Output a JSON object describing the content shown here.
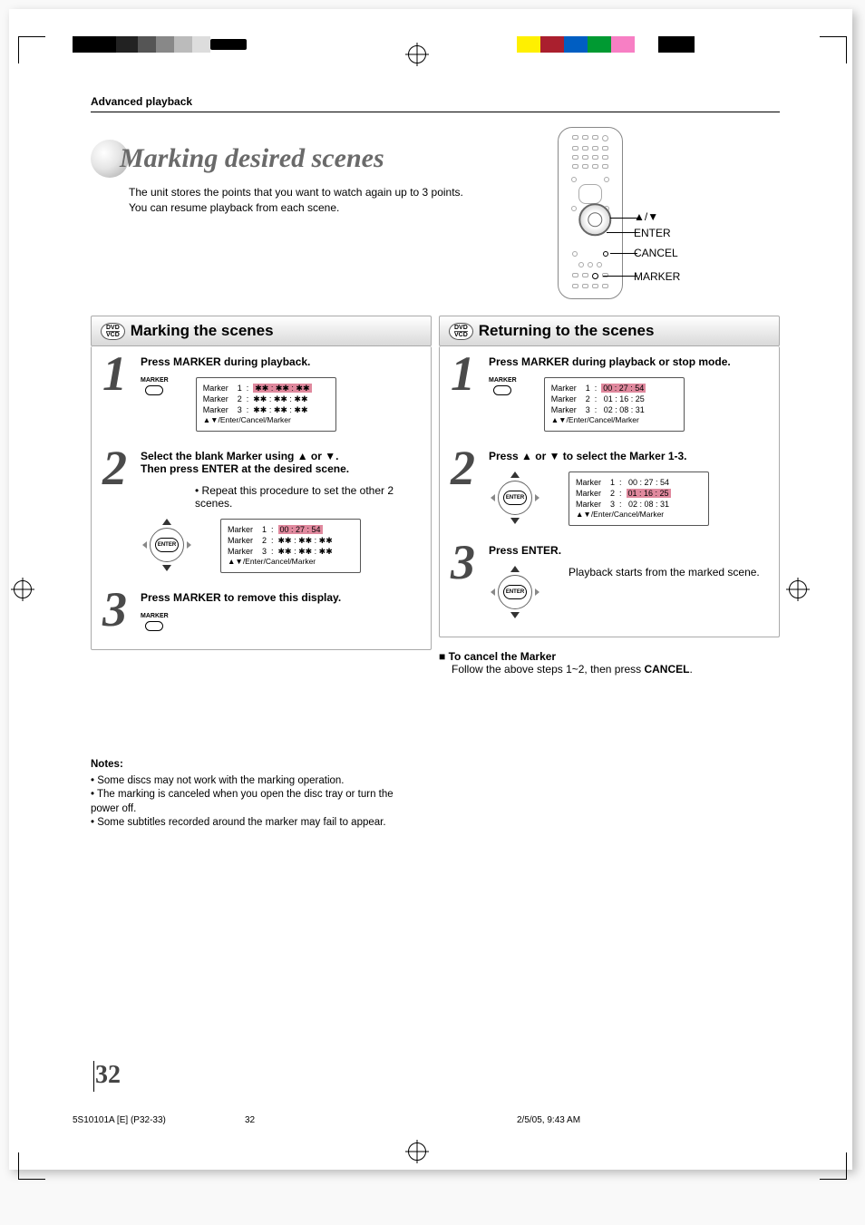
{
  "header": {
    "section": "Advanced playback"
  },
  "title": "Marking desired scenes",
  "intro_line1": "The unit stores the points that you want to watch again up to 3 points.",
  "intro_line2": "You can resume playback from each scene.",
  "remote_labels": {
    "arrows": "▲/▼",
    "enter": "ENTER",
    "cancel": "CANCEL",
    "marker": "MARKER"
  },
  "badge": {
    "dvd": "DVD",
    "vcd": "VCD"
  },
  "left": {
    "heading": "Marking the scenes",
    "step1": {
      "title": "Press MARKER during playback.",
      "osd": {
        "r1a": "Marker    1  :  ",
        "r1b": "✱✱ : ✱✱ : ✱✱",
        "r2": "Marker    2  :  ✱✱ : ✱✱ : ✱✱",
        "r3": "Marker    3  :  ✱✱ : ✱✱ : ✱✱",
        "footer": "▲▼/Enter/Cancel/Marker"
      }
    },
    "step2": {
      "title_l1": "Select the blank Marker using ▲ or ▼.",
      "title_l2": "Then press ENTER at the desired scene.",
      "note": "• Repeat this procedure to set the other 2 scenes.",
      "osd": {
        "r1a": "Marker    1  :  ",
        "r1b": "00 : 27 : 54",
        "r2": "Marker    2  :  ✱✱ : ✱✱ : ✱✱",
        "r3": "Marker    3  :  ✱✱ : ✱✱ : ✱✱",
        "footer": "▲▼/Enter/Cancel/Marker"
      }
    },
    "step3": {
      "title": "Press MARKER to remove this display."
    }
  },
  "right": {
    "heading": "Returning to the scenes",
    "step1": {
      "title": "Press MARKER during playback or stop mode.",
      "osd": {
        "r1a": "Marker    1  :  ",
        "r1b": "00 : 27 : 54",
        "r2": "Marker    2  :   01 : 16 : 25",
        "r3": "Marker    3  :   02 : 08 : 31",
        "footer": "▲▼/Enter/Cancel/Marker"
      }
    },
    "step2": {
      "title": "Press ▲ or ▼ to select the Marker 1-3.",
      "osd": {
        "r1": "Marker    1  :   00 : 27 : 54",
        "r2a": "Marker    2  :  ",
        "r2b": "01 : 16 : 25",
        "r3": "Marker    3  :   02 : 08 : 31",
        "footer": "▲▼/Enter/Cancel/Marker"
      }
    },
    "step3": {
      "title": "Press ENTER.",
      "note": "Playback starts from the marked scene."
    },
    "cancel": {
      "heading": "To cancel the Marker",
      "text_a": "Follow the above steps 1~2, then press ",
      "text_b": "CANCEL",
      "text_c": "."
    }
  },
  "notes": {
    "heading": "Notes:",
    "n1": "• Some discs may not work with the marking operation.",
    "n2": "• The marking is canceled when you open the disc tray or turn the power off.",
    "n3": "• Some subtitles recorded around the marker may fail to appear."
  },
  "page_number": "32",
  "footer": {
    "doc": "5S10101A [E] (P32-33)",
    "page": "32",
    "timestamp": "2/5/05, 9:43 AM"
  },
  "icons": {
    "marker_label": "MARKER",
    "enter_label": "ENTER"
  }
}
